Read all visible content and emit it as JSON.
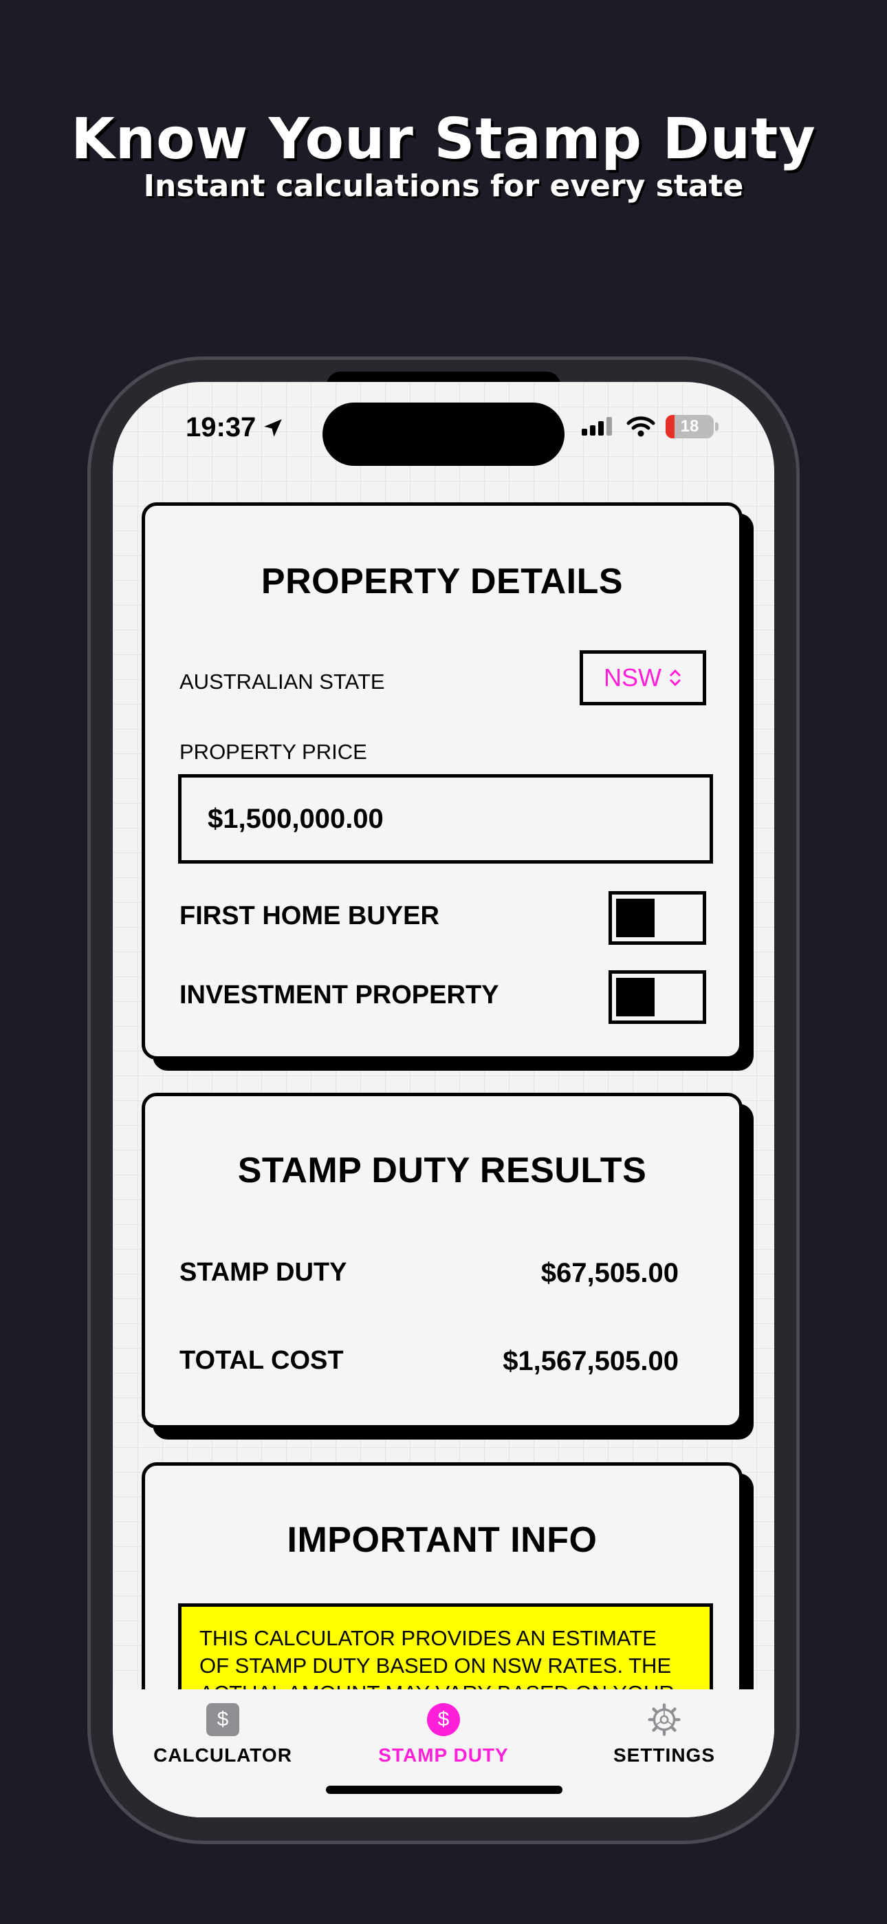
{
  "promo": {
    "headline": "Know Your Stamp Duty",
    "subline": "Instant calculations for every state"
  },
  "status_bar": {
    "time": "19:37",
    "battery": "18",
    "battery_level": 0.18,
    "battery_color": "#e8302a"
  },
  "property_details": {
    "title": "PROPERTY DETAILS",
    "state_label": "AUSTRALIAN STATE",
    "state_value": "NSW",
    "price_label": "PROPERTY PRICE",
    "price_value": "$1,500,000.00",
    "first_home_label": "FIRST HOME BUYER",
    "first_home_on": false,
    "investment_label": "INVESTMENT PROPERTY",
    "investment_on": false
  },
  "results": {
    "title": "STAMP DUTY RESULTS",
    "stamp_duty_label": "STAMP DUTY",
    "stamp_duty_value": "$67,505.00",
    "total_cost_label": "TOTAL COST",
    "total_cost_value": "$1,567,505.00"
  },
  "info": {
    "title": "IMPORTANT INFO",
    "text": "THIS CALCULATOR PROVIDES AN ESTIMATE OF STAMP DUTY BASED ON NSW RATES. THE ACTUAL AMOUNT MAY VARY BASED ON YOUR"
  },
  "tabs": [
    {
      "label": "CALCULATOR",
      "icon": "dollar-square-icon",
      "active": false
    },
    {
      "label": "STAMP DUTY",
      "icon": "dollar-circle-icon",
      "active": true
    },
    {
      "label": "SETTINGS",
      "icon": "gear-icon",
      "active": false
    }
  ],
  "colors": {
    "accent": "#ff1fd8",
    "highlight": "#ffff00",
    "background": "#1b1c25"
  }
}
